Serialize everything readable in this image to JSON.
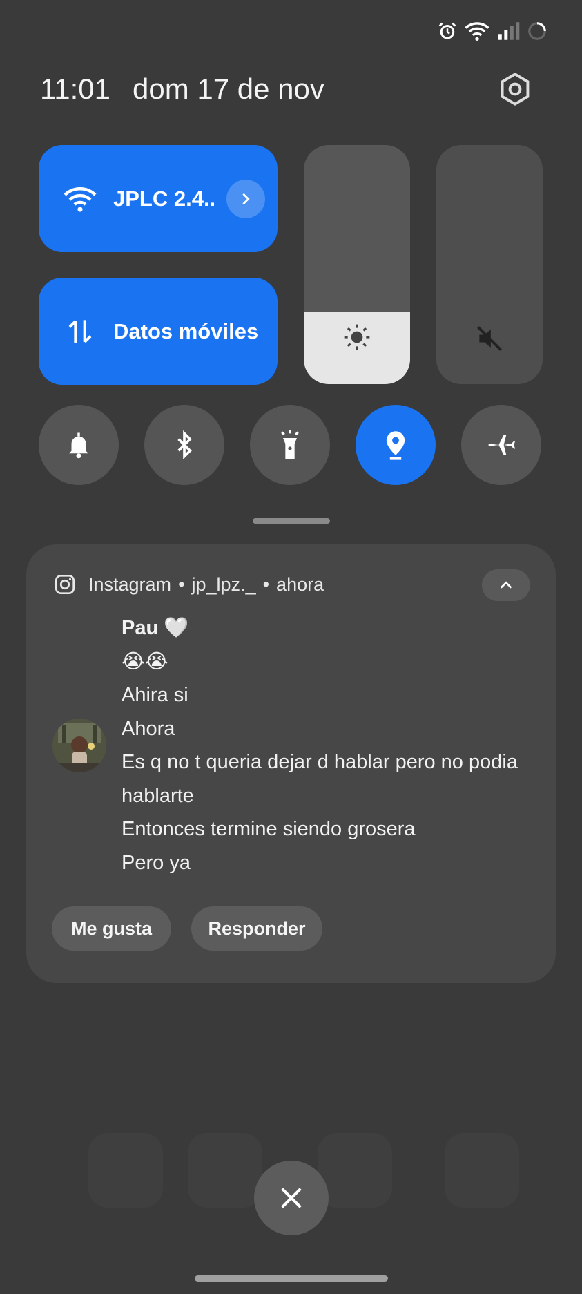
{
  "status_bar": {
    "icons": [
      "alarm-icon",
      "wifi-icon",
      "signal-icon",
      "loading-icon"
    ]
  },
  "header": {
    "time": "11:01",
    "date": "dom 17 de nov",
    "settings_icon": "gear-icon"
  },
  "quick_tiles": {
    "wifi": {
      "label": "JPLC 2.4..",
      "icon": "wifi-icon",
      "expand_icon": "chevron-right-icon",
      "active": true
    },
    "mobile_data": {
      "label": "Datos móviles",
      "icon": "data-arrows-icon",
      "active": true
    }
  },
  "sliders": {
    "brightness": {
      "icon": "sun-icon",
      "level": 0.3
    },
    "volume": {
      "icon": "mute-icon",
      "level": 0.0
    }
  },
  "toggles": [
    {
      "name": "sound",
      "icon": "bell-icon",
      "active": false
    },
    {
      "name": "bluetooth",
      "icon": "bluetooth-icon",
      "active": false
    },
    {
      "name": "flashlight",
      "icon": "flashlight-icon",
      "active": false
    },
    {
      "name": "location",
      "icon": "location-icon",
      "active": true
    },
    {
      "name": "airplane",
      "icon": "airplane-icon",
      "active": false
    }
  ],
  "notification": {
    "app": "Instagram",
    "account": "jp_lpz._",
    "time": "ahora",
    "separator": "•",
    "sender": "Pau 🤍",
    "lines": [
      "😭😭",
      "Ahira si",
      "Ahora",
      "Es q no t queria dejar d hablar pero no podia hablarte",
      "Entonces termine siendo grosera",
      "Pero ya"
    ],
    "actions": {
      "like": "Me gusta",
      "reply": "Responder"
    }
  },
  "colors": {
    "accent": "#1a73f0",
    "background": "#3a3a3a",
    "card": "#474747"
  }
}
